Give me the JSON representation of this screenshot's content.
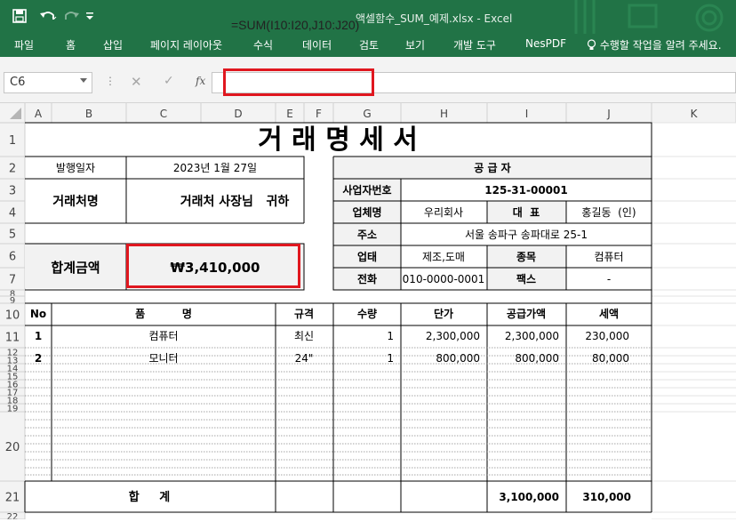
{
  "app": {
    "title": "액셀함수_SUM_예제.xlsx  -  Excel"
  },
  "qat": [
    "save-icon",
    "undo-icon",
    "redo-icon",
    "customize-icon"
  ],
  "ribbon": {
    "tabs": [
      "파일",
      "홈",
      "삽입",
      "페이지 레이아웃",
      "수식",
      "데이터",
      "검토",
      "보기",
      "개발 도구",
      "NesPDF"
    ],
    "tell_me": "수행할 작업을 알려 주세요."
  },
  "formula_bar": {
    "name_box": "C6",
    "fx": "fx",
    "formula": "=SUM(I10:I20,J10:J20)"
  },
  "columns": [
    "A",
    "B",
    "C",
    "D",
    "E",
    "F",
    "G",
    "H",
    "I",
    "J",
    "K"
  ],
  "rows": [
    "1",
    "2",
    "3",
    "4",
    "5",
    "6",
    "7",
    "8",
    "9",
    "10",
    "11",
    "12",
    "13",
    "14",
    "15",
    "16",
    "17",
    "18",
    "19",
    "20",
    "21",
    "22"
  ],
  "invoice": {
    "title": "거 래 명 세 서",
    "issue_date_label": "발행일자",
    "issue_date": "2023년 1월 27일",
    "client_label": "거래처명",
    "client_value": "거래처 사장님   귀하",
    "total_label": "합계금액",
    "total_value": "₩3,410,000",
    "supplier_header": "공 급 자",
    "biz_no_label": "사업자번호",
    "biz_no": "125-31-00001",
    "company_label": "업체명",
    "company": "우리회사",
    "rep_label": "대  표",
    "rep": "홍길동  (인)",
    "address_label": "주소",
    "address": "서울 송파구 송파대로 25-1",
    "business_type_label": "업태",
    "business_type": "제조,도매",
    "item_type_label": "종목",
    "item_type": "컴퓨터",
    "phone_label": "전화",
    "phone": "010-0000-0001",
    "fax_label": "팩스",
    "fax": "-",
    "table_headers": {
      "no": "No",
      "item": "품          명",
      "spec": "규격",
      "qty": "수량",
      "unit_price": "단가",
      "supply": "공급가액",
      "tax": "세액"
    },
    "items": [
      {
        "no": "1",
        "name": "컴퓨터",
        "spec": "최신",
        "qty": "1",
        "unit_price": "2,300,000",
        "supply": "2,300,000",
        "tax": "230,000"
      },
      {
        "no": "2",
        "name": "모니터",
        "spec": "24\"",
        "qty": "1",
        "unit_price": "800,000",
        "supply": "800,000",
        "tax": "80,000"
      }
    ],
    "sum_label": "합     계",
    "sum_supply": "3,100,000",
    "sum_tax": "310,000"
  }
}
